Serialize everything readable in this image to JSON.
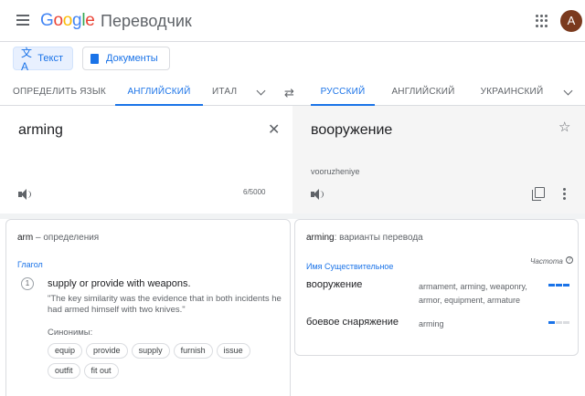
{
  "header": {
    "logo_letters": [
      "G",
      "o",
      "o",
      "g",
      "l",
      "e"
    ],
    "product": "Переводчик",
    "avatar_letter": "A"
  },
  "modes": {
    "text": "Текст",
    "documents": "Документы"
  },
  "source_langs": [
    "ОПРЕДЕЛИТЬ ЯЗЫК",
    "АНГЛИЙСКИЙ",
    "ИТАЛ"
  ],
  "target_langs": [
    "РУССКИЙ",
    "АНГЛИЙСКИЙ",
    "УКРАИНСКИЙ"
  ],
  "source": {
    "text": "arming",
    "char_count": "6/5000"
  },
  "target": {
    "text": "вооружение",
    "transliteration": "vooruzheniye"
  },
  "definitions": {
    "word": "arm",
    "title_suffix": " – определения",
    "part_of_speech": "Глагол",
    "number": "1",
    "definition": "supply or provide with weapons.",
    "example": "\"The key similarity was the evidence that in both incidents he had armed himself with two knives.\"",
    "synonyms_label": "Синонимы:",
    "synonyms": [
      "equip",
      "provide",
      "supply",
      "furnish",
      "issue",
      "outfit",
      "fit out"
    ]
  },
  "alternatives": {
    "word": "arming",
    "title_suffix": ": варианты перевода",
    "frequency_label": "Частота",
    "part_of_speech": "Имя Существительное",
    "rows": [
      {
        "word": "вооружение",
        "back": "armament, arming, weaponry, armor, equipment, armature",
        "frequency": 3
      },
      {
        "word": "боевое снаряжение",
        "back": "arming",
        "frequency": 1
      }
    ]
  },
  "colors": {
    "accent": "#1a73e8",
    "target_bg": "#f5f5f5",
    "avatar": "#7b3a1e"
  }
}
